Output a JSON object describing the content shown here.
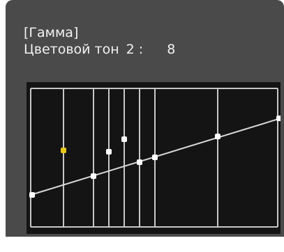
{
  "osd": {
    "title": "[Гамма]",
    "parameter_label": "Цветовой тон",
    "parameter_index": "2 :",
    "parameter_value": "8"
  },
  "colors": {
    "background": "#4a4a4a",
    "graph_background": "#141414",
    "grid_line": "#c8c8c8",
    "point": "#ffffff",
    "selected_point": "#e6c619"
  },
  "gamma_curve": {
    "selected_index": 1,
    "points": [
      "p0",
      "p1",
      "p2",
      "p3",
      "p4",
      "p5",
      "p6",
      "p7",
      "p8"
    ]
  }
}
